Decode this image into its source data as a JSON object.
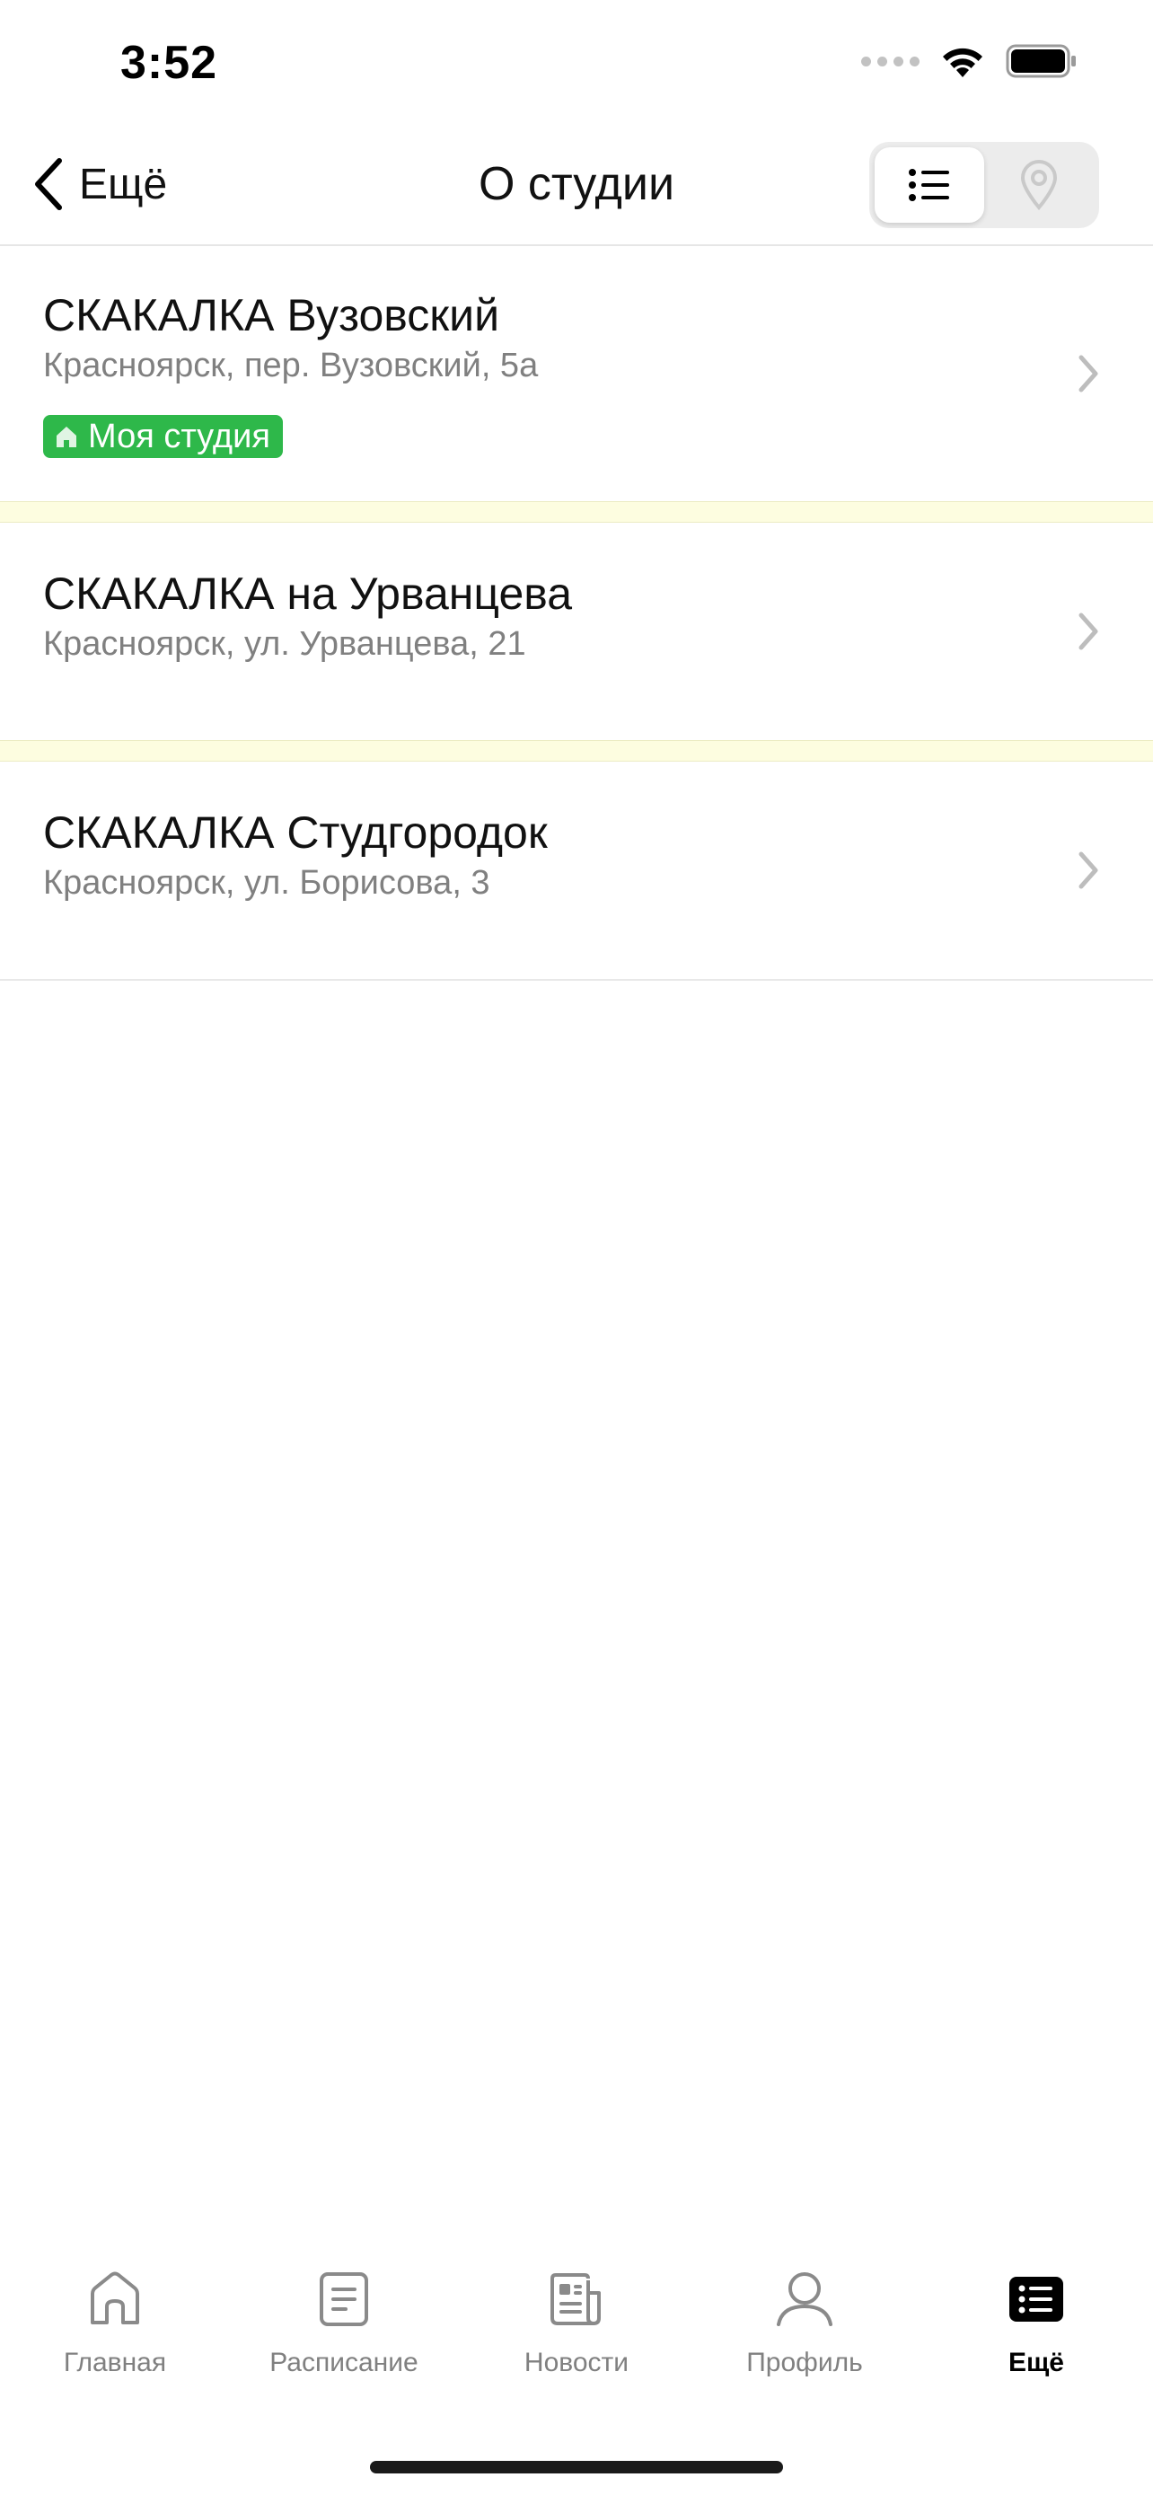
{
  "status_bar": {
    "time": "3:52"
  },
  "nav": {
    "back_label": "Ещё",
    "title": "О студии",
    "view_toggle": {
      "options": [
        "list-icon",
        "map-pin-icon"
      ],
      "selected": "list-icon"
    }
  },
  "studios": [
    {
      "name": "СКАКАЛКА Вузовский",
      "address": "Красноярск, пер. Вузовский, 5а",
      "badge": "Моя студия"
    },
    {
      "name": "СКАКАЛКА на Урванцева",
      "address": "Красноярск, ул. Урванцева, 21"
    },
    {
      "name": "СКАКАЛКА Студгородок",
      "address": "Красноярск, ул. Борисова, 3"
    }
  ],
  "tab_bar": {
    "items": [
      {
        "label": "Главная",
        "icon": "home-icon"
      },
      {
        "label": "Расписание",
        "icon": "schedule-icon"
      },
      {
        "label": "Новости",
        "icon": "news-icon"
      },
      {
        "label": "Профиль",
        "icon": "profile-icon"
      },
      {
        "label": "Ещё",
        "icon": "more-icon"
      }
    ],
    "active": "Ещё"
  },
  "colors": {
    "badge_green": "#2eb84a",
    "separator_yellow": "#fdfde0",
    "secondary_text": "#808080"
  }
}
